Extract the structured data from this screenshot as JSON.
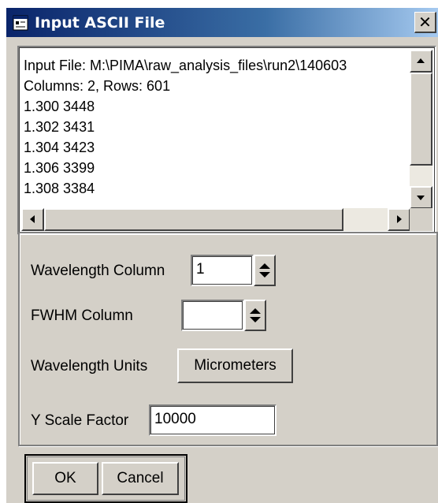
{
  "window": {
    "title": "Input ASCII File",
    "close_label": "✕"
  },
  "file_preview": {
    "lines": [
      "Input File: M:\\PIMA\\raw_analysis_files\\run2\\140603",
      "Columns: 2, Rows: 601",
      "1.300 3448",
      "1.302 3431",
      "1.304 3423",
      "1.306 3399",
      "1.308 3384"
    ]
  },
  "form": {
    "wavelength_column": {
      "label": "Wavelength Column",
      "value": "1"
    },
    "fwhm_column": {
      "label": "FWHM Column",
      "value": ""
    },
    "wavelength_units": {
      "label": "Wavelength Units",
      "button_label": "Micrometers"
    },
    "y_scale_factor": {
      "label": "Y Scale Factor",
      "value": "10000"
    }
  },
  "buttons": {
    "ok_label": "OK",
    "cancel_label": "Cancel"
  }
}
